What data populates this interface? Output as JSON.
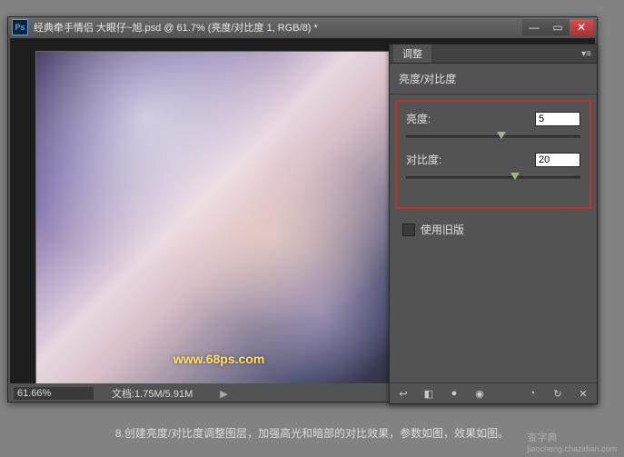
{
  "window": {
    "ps_icon": "Ps",
    "title": "经典牵手情侣   大眼仔~旭.psd @ 61.7% (亮度/对比度 1, RGB/8) *"
  },
  "status": {
    "zoom": "61.66%",
    "doc": "文档:1.75M/5.91M",
    "arrow": "▶"
  },
  "image": {
    "watermark": "www.68ps.com"
  },
  "panel": {
    "tab": "调整",
    "menu_icon": "▾≡",
    "subtitle": "亮度/对比度",
    "brightness": {
      "label": "亮度:",
      "value": "5",
      "pos_pct": 52
    },
    "contrast": {
      "label": "对比度:",
      "value": "20",
      "pos_pct": 60
    },
    "legacy": "使用旧版",
    "bottom_icons": [
      "↩",
      "◧",
      "●",
      "◉",
      "◔",
      "↻",
      "✕"
    ]
  },
  "caption": "8.创建亮度/对比度调整图层，加强高光和暗部的对比效果，参数如图，效果如图。",
  "site": {
    "name": "查字典",
    "url": "jiaocheng.chazidian.com"
  }
}
